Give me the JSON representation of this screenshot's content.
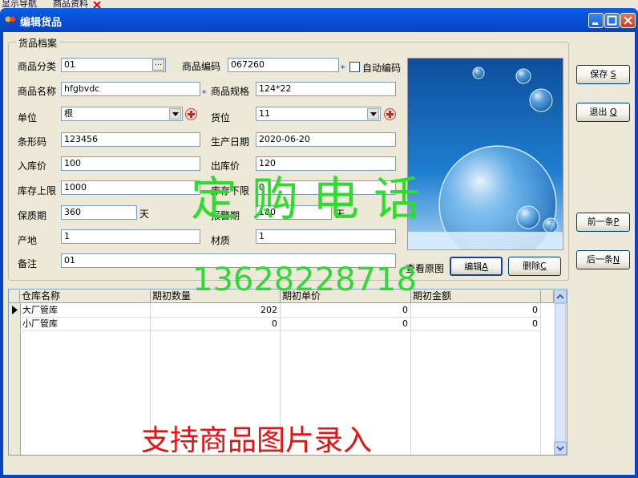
{
  "tabs": [
    "显示导航",
    "商品资料"
  ],
  "window": {
    "title": "编辑货品"
  },
  "group": {
    "title": "货品档案"
  },
  "form": {
    "category_label": "商品分类",
    "category_value": "01",
    "code_label": "商品编码",
    "code_value": "067260",
    "auto_code_label": "自动编码",
    "name_label": "商品名称",
    "name_value": "hfgbvdc",
    "spec_label": "商品规格",
    "spec_value": "124*22",
    "unit_label": "单位",
    "unit_value": "根",
    "location_label": "货位",
    "location_value": "11",
    "barcode_label": "条形码",
    "barcode_value": "123456",
    "prod_date_label": "生产日期",
    "prod_date_value": "2020-06-20",
    "in_price_label": "入库价",
    "in_price_value": "100",
    "out_price_label": "出库价",
    "out_price_value": "120",
    "stock_max_label": "库存上限",
    "stock_max_value": "1000",
    "stock_min_label": "库存下限",
    "stock_min_value": "0",
    "shelf_label": "保质期",
    "shelf_value": "360",
    "shelf_unit": "天",
    "warn_label": "报警期",
    "warn_value": "180",
    "warn_unit": "天",
    "origin_label": "产地",
    "origin_value": "1",
    "material_label": "材质",
    "material_value": "1",
    "note_label": "备注",
    "note_value": "01",
    "required_mark": "*"
  },
  "image_panel": {
    "view_label": "查看原图",
    "edit_label": "编辑",
    "edit_key": "A",
    "delete_label": "删除",
    "delete_key": "C"
  },
  "buttons": {
    "save": "保存",
    "save_key": "S",
    "exit": "退出",
    "exit_key": "Q",
    "prev": "前一条",
    "prev_key": "P",
    "next": "后一条",
    "next_key": "N"
  },
  "grid": {
    "columns": [
      "仓库名称",
      "期初数量",
      "期初单价",
      "期初金额"
    ],
    "rows": [
      [
        "大厂管库",
        "202",
        "0",
        "0"
      ],
      [
        "小厂管库",
        "0",
        "0",
        "0"
      ]
    ]
  },
  "watermarks": {
    "phone_label": "定购电话",
    "phone_number": "13628228718",
    "feature": "支持商品图片录入"
  },
  "colors": {
    "titlebar": "#0751d8",
    "watermark_green": "#2ddc2d",
    "watermark_red": "#e81010"
  }
}
